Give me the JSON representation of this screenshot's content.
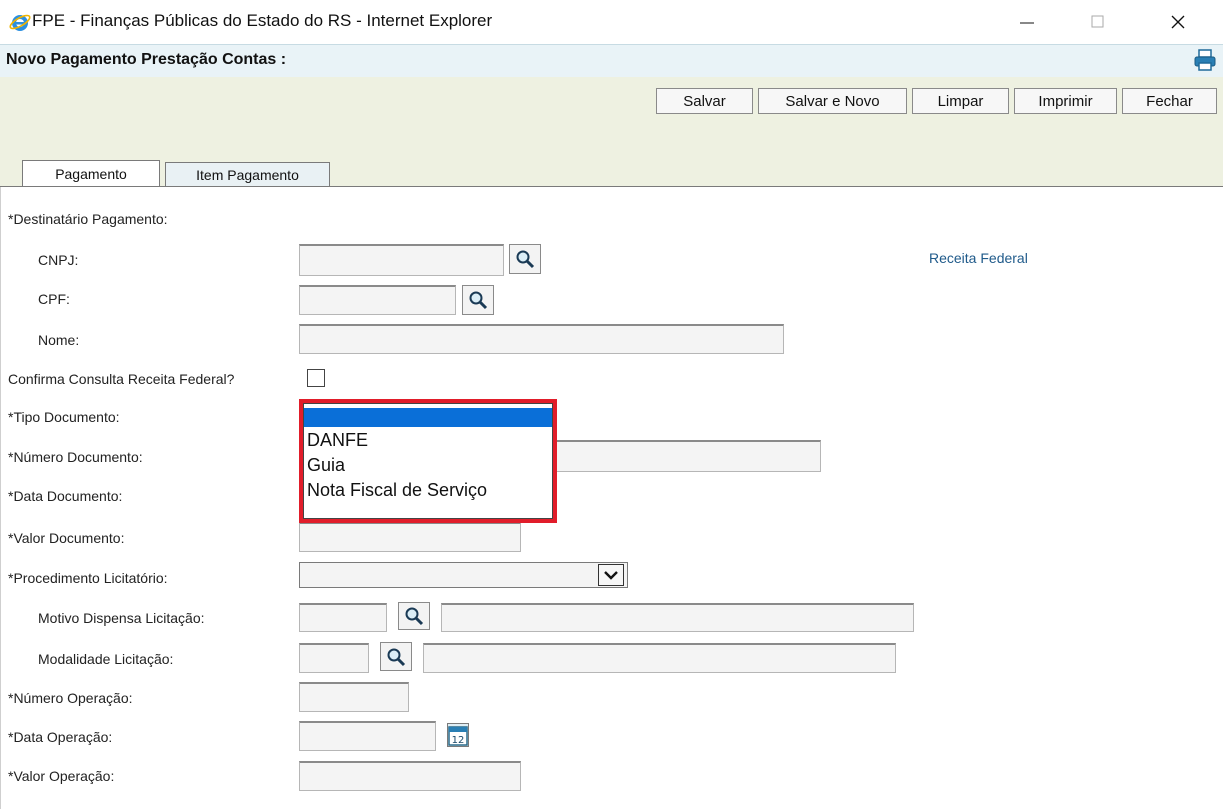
{
  "window": {
    "title": "FPE - Finanças Públicas do Estado do RS - Internet Explorer"
  },
  "page": {
    "title": "Novo Pagamento Prestação Contas :"
  },
  "toolbar": {
    "salvar": "Salvar",
    "salvar_novo": "Salvar e Novo",
    "limpar": "Limpar",
    "imprimir": "Imprimir",
    "fechar": "Fechar"
  },
  "tabs": [
    {
      "label": "Pagamento",
      "active": true
    },
    {
      "label": "Item Pagamento",
      "active": false
    }
  ],
  "form": {
    "destinatario": "*Destinatário Pagamento:",
    "cnpj": "CNPJ:",
    "cpf": "CPF:",
    "nome": "Nome:",
    "receita_link": "Receita Federal",
    "confirma": "Confirma Consulta Receita Federal?",
    "tipo_documento": "*Tipo Documento:",
    "numero_documento": "*Número Documento:",
    "data_documento": "*Data Documento:",
    "valor_documento": "*Valor Documento:",
    "procedimento": "*Procedimento Licitatório:",
    "motivo_dispensa": "Motivo Dispensa Licitação:",
    "modalidade": "Modalidade Licitação:",
    "numero_operacao": "*Número Operação:",
    "data_operacao": "*Data Operação:",
    "valor_operacao": "*Valor Operação:"
  },
  "tipo_documento_dropdown": {
    "options": [
      "",
      "DANFE",
      "Guia",
      "Nota Fiscal de Serviço"
    ],
    "selected_index": 0
  },
  "calendar_day": "12",
  "colors": {
    "highlight_outline": "#e11d2a",
    "selection": "#0a6fd8",
    "toolbar_bg": "#eef1e1",
    "header_bg": "#e9f3f7",
    "link": "#1f5a8a"
  }
}
